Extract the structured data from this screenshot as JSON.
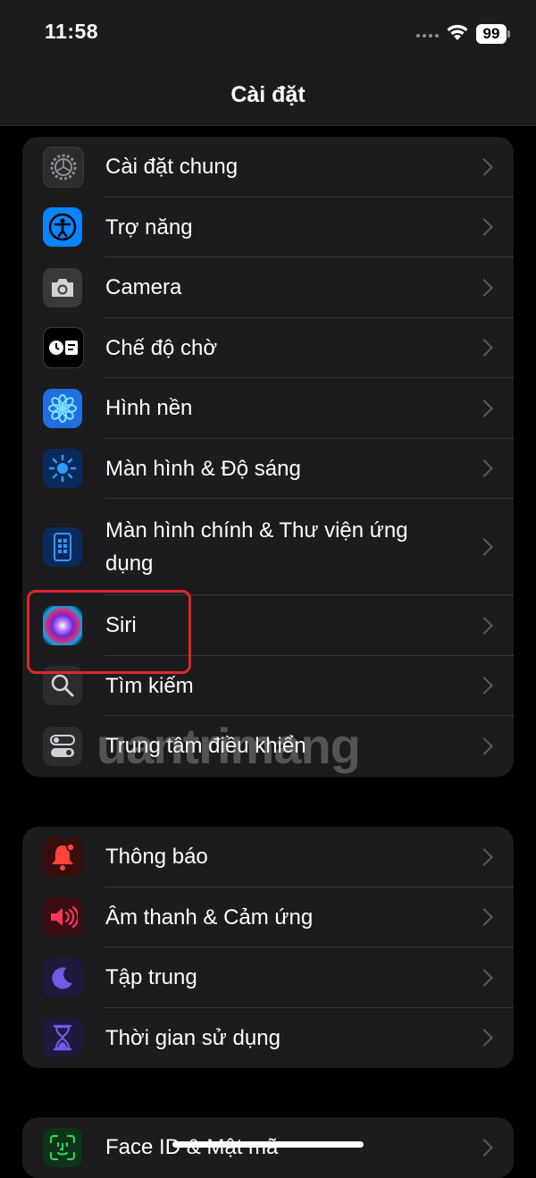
{
  "status": {
    "time": "11:58",
    "battery": "99"
  },
  "nav": {
    "title": "Cài đặt"
  },
  "groups": [
    {
      "items": [
        {
          "label": "Cài đặt chung",
          "icon": "gear-icon"
        },
        {
          "label": "Trợ năng",
          "icon": "accessibility-icon"
        },
        {
          "label": "Camera",
          "icon": "camera-icon"
        },
        {
          "label": "Chế độ chờ",
          "icon": "standby-icon"
        },
        {
          "label": "Hình nền",
          "icon": "wallpaper-flower-icon"
        },
        {
          "label": "Màn hình & Độ sáng",
          "icon": "brightness-icon"
        },
        {
          "label": "Màn hình chính & Thư viện ứng dụng",
          "icon": "home-screen-icon"
        },
        {
          "label": "Siri",
          "icon": "siri-icon"
        },
        {
          "label": "Tìm kiếm",
          "icon": "search-icon"
        },
        {
          "label": "Trung tâm điều khiển",
          "icon": "control-center-icon"
        }
      ]
    },
    {
      "items": [
        {
          "label": "Thông báo",
          "icon": "bell-icon"
        },
        {
          "label": "Âm thanh & Cảm ứng",
          "icon": "speaker-icon"
        },
        {
          "label": "Tập trung",
          "icon": "moon-icon"
        },
        {
          "label": "Thời gian sử dụng",
          "icon": "hourglass-icon"
        }
      ]
    },
    {
      "items": [
        {
          "label": "Face ID & Mật mã",
          "icon": "face-id-icon"
        }
      ]
    }
  ],
  "watermark": "uantrimang",
  "colors": {
    "accent_red": "#e0262a",
    "group_bg": "#1c1c1e"
  }
}
